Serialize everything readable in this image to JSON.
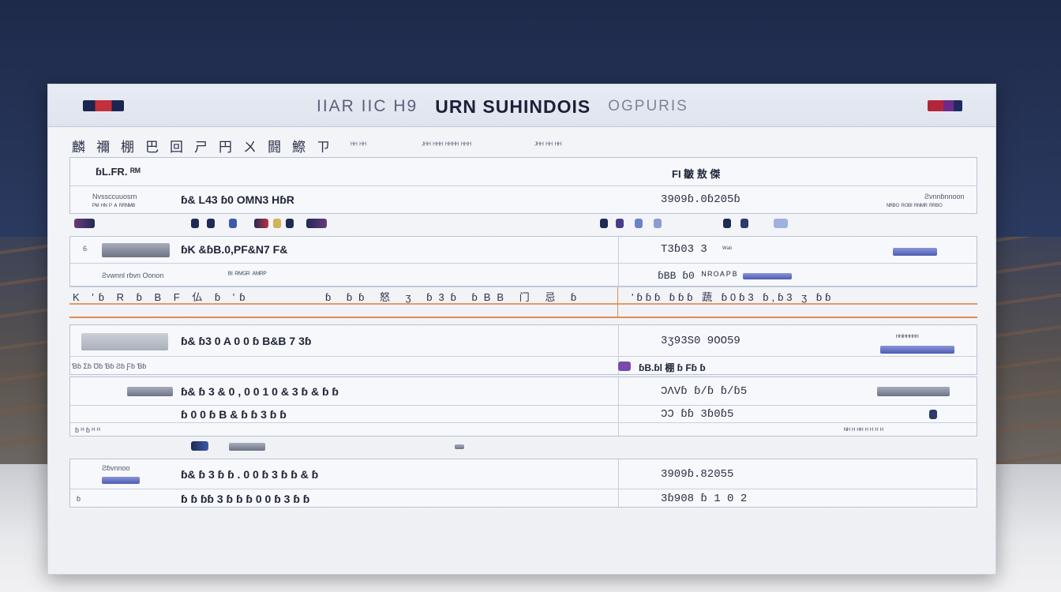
{
  "window": {
    "title_pre": "IIAR IIC H9",
    "title_main": "URN SUHINDOIS",
    "title_post": "OGPURIS"
  },
  "toolbar": {
    "items": [
      "麟",
      "禰",
      "棚",
      "巴",
      "回",
      "ㄕ",
      "円",
      "ㄨ",
      "闘",
      "鰶",
      "ㄗ"
    ],
    "meta": [
      "ᴴᴴ ᴴᴴ",
      "ᴶᴴᴴ ᴴᴴᴴ ᴴᴴᴴᴴ ᴴᴴᴴ",
      "ᴶᴴᴴ ᴴᴴ ᴴᴴ"
    ]
  },
  "section1": {
    "header_left": "ɓL.FR. ᴿᴹ",
    "header_right": "FI 皺 敖 傑",
    "row_small1": "Nvssccuuosrn",
    "row_small2": "ᴾᴹ ᴴᴺ ᴾ ᴬ ᴿᴿᴺᴹᴮ",
    "row_main": "ɓ& L43 ɓ0 OMN3 HɓR",
    "row_value": "3909ɓ.0ɓ205ɓ",
    "row_right1": "Ƨvnnɓnnoon",
    "row_right2": "ᴺᴿᴮᴼ ᴿᴼᴮᴵ ᴿᴺᴹᴿ ᴿᴿᴮᴼ"
  },
  "section2": {
    "row1_main": "ɓK &ɓB.0,PF&N7 F&",
    "row1_value": "T3ɓ03 3",
    "row1_label": "ᵂᵃᵇ",
    "row2_small": "Ƨvwnnl rɓvn Oonon",
    "row2_mid": "ᴮᴵ ᴿᴹᴳᴿ ᴬᴹᴿᴾ",
    "row2_value": "ɓBB ɓ0 ᴺᴿᴼᴬᴾᴮ",
    "stripe_left": "K 'ɓ R ɓ B F 仏 ɓ 'ɓ",
    "stripe_mid": "ɓ ɓɓ 怒 ʒ ɓ3ɓ ɓBB 门 忌 ɓ",
    "stripe_right": "'ɓɓɓ ɓɓɓ 蔬 ɓ0ɓ3 ɓ,ɓ3 ʒ ɓɓ"
  },
  "section3": {
    "row1_main": "ɓ& ɓ3 0 A 0 0 ɓ B&B 7 3ɓ",
    "row1_value": "3ʒ93S0 9OO59",
    "row1_note": "ᴴᴴᴵᴴᴴᴴᴴᴴ",
    "row2_small": "Ɓɓ Ʃɓ Ʊɓ Ɓɓ Ƨɓ Ƒɓ Ɓɓ",
    "row2_tag": "ɓB.ɓl 棚 ɓ Fɓ ɓ"
  },
  "section4": {
    "row1_main": "ɓ& ɓ 3 & 0 , 0 0 1 0 & 3 ɓ & ɓ ɓ",
    "row1_value": "ƆΛVɓ ɓ/ɓ ɓ/ɓ5",
    "row2_main": "ɓ 0 0 ɓ B & ɓ ɓ 3 ɓ ɓ",
    "row2_value": "ƆƆ ɓɓ 3ɓ0ɓ5",
    "row3_small": "ɓ ᴴ ɓ ᴴ ᴴ",
    "row3_mid": "ᴺᴴ ᴴ ᴴᴴ ᴴ ᴴ ᴴ ᴴ"
  },
  "section5": {
    "row1_label": "Ƨɓvnnoo",
    "row1_main": "ɓ& ɓ 3 ɓ ɓ . 0 0 ɓ 3 ɓ ɓ & ɓ",
    "row1_value": "3909ɓ.82055",
    "row2_main": "ɓ ɓ ɓɓ 3 ɓ ɓ ɓ 0 0 ɓ 3 ɓ ɓ",
    "row2_value": "3ɓ908 ɓ 1 0 2"
  },
  "colors": {
    "accent_orange": "#e08a55",
    "brand_red": "#c2313c",
    "navy": "#1c2550"
  }
}
